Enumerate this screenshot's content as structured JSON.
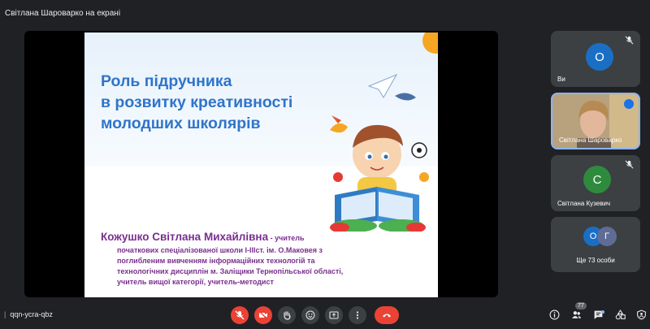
{
  "header": {
    "presenter_label": "Світлана Шароварко на екрані"
  },
  "slide": {
    "title_lines": [
      "Роль підручника",
      "в розвитку креативності",
      "молодших школярів"
    ],
    "author": "Кожушко Світлана Михайлівна",
    "author_role": " - учитель",
    "description_lines": [
      "початкових спеціалізованої школи І-ІІІст. ім. О.Маковея з",
      "поглибленим вивченням інформаційних технологій та",
      "технологічних дисциплін м. Заліщики Тернопільської області,",
      "учитель  вищої категорії, учитель-методист"
    ]
  },
  "participants": {
    "you": {
      "initial": "О",
      "name": "Ви"
    },
    "presenter": {
      "name": "Світлана Шароварко"
    },
    "second": {
      "initial": "С",
      "name": "Світлана Кузевич"
    },
    "more": {
      "initials": [
        "О",
        "Г"
      ],
      "label": "Ще 73 особи"
    }
  },
  "footer": {
    "separator": "|",
    "meeting_code": "qqn-ycra-qbz",
    "participants_count": "77"
  },
  "colors": {
    "background": "#202124",
    "tile": "#3c4043",
    "danger": "#ea4335",
    "accent": "#8ab4f8",
    "title_blue": "#2e75c9",
    "author_purple": "#7a2f8f"
  },
  "icons": {
    "controls": [
      "mic-off-icon",
      "camera-off-icon",
      "raise-hand-icon",
      "emoji-icon",
      "present-screen-icon",
      "more-options-icon",
      "hang-up-icon"
    ],
    "right": [
      "info-icon",
      "people-icon",
      "chat-icon",
      "activities-icon",
      "host-controls-icon"
    ]
  }
}
